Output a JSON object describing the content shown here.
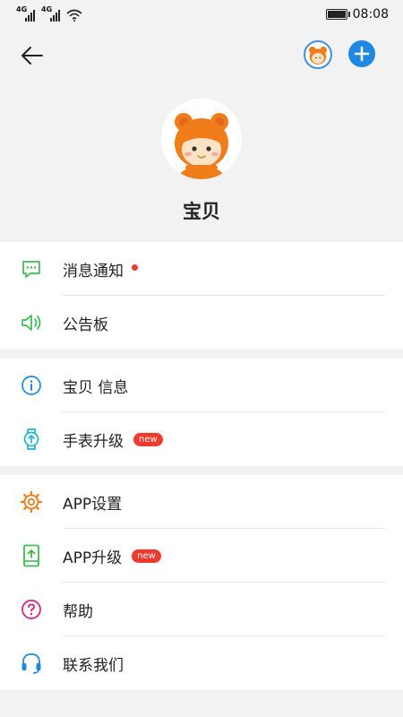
{
  "status_bar": {
    "signal_1_tag": "4G",
    "signal_2_tag": "4G",
    "time": "08:08",
    "battery_icon": "battery-full-icon",
    "wifi_icon": "wifi-icon"
  },
  "header": {
    "back_icon": "back-arrow-icon",
    "add_icon": "plus-icon"
  },
  "profile": {
    "name": "宝贝"
  },
  "menu": {
    "group1": [
      {
        "label": "消息通知",
        "icon": "message-icon",
        "dot": true
      },
      {
        "label": "公告板",
        "icon": "speaker-icon"
      }
    ],
    "group2": [
      {
        "label": "宝贝 信息",
        "icon": "info-icon"
      },
      {
        "label": "手表升级",
        "icon": "watch-icon",
        "badge": "new"
      }
    ],
    "group3": [
      {
        "label": "APP设置",
        "icon": "gear-icon"
      },
      {
        "label": "APP升级",
        "icon": "phone-upgrade-icon",
        "badge": "new"
      },
      {
        "label": "帮助",
        "icon": "help-icon"
      },
      {
        "label": "联系我们",
        "icon": "headset-icon"
      }
    ]
  },
  "colors": {
    "accent_blue": "#1e88e5",
    "green": "#3cba54",
    "badge_red": "#f03a2e",
    "orange": "#f07c1a",
    "magenta": "#d81b7a",
    "teal": "#19b6c9"
  }
}
